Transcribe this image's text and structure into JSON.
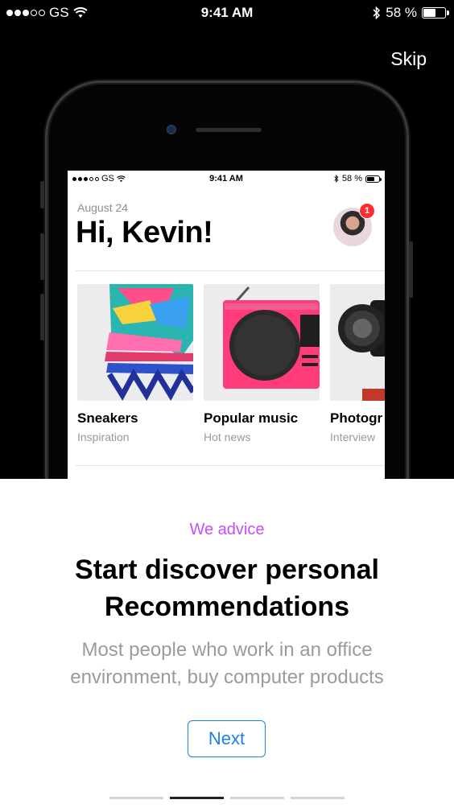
{
  "status_bar": {
    "carrier": "GS",
    "time": "9:41 AM",
    "battery": "58 %"
  },
  "skip_label": "Skip",
  "phone_screen": {
    "status_bar": {
      "carrier": "GS",
      "time": "9:41 AM",
      "battery": "58 %"
    },
    "date": "August 24",
    "greeting": "Hi, Kevin!",
    "notification_count": "1",
    "cards": [
      {
        "title": "Sneakers",
        "subtitle": "Inspiration"
      },
      {
        "title": "Popular music",
        "subtitle": "Hot news"
      },
      {
        "title": "Photogr",
        "subtitle": "Interview"
      }
    ]
  },
  "onboarding": {
    "eyebrow": "We advice",
    "headline_line1": "Start discover personal",
    "headline_line2": "Recommendations",
    "body_line1": "Most people who work in an office",
    "body_line2": "environment, buy computer products",
    "next_label": "Next"
  },
  "pager": {
    "total": 4,
    "active": 2
  },
  "colors": {
    "accent_purple": "#c84cff",
    "button_blue": "#1a82e6",
    "badge_red": "#ff2d2d"
  }
}
